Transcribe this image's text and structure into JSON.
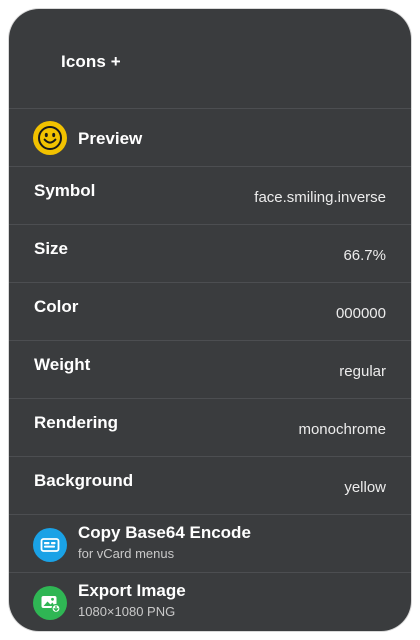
{
  "header": {
    "title": "Icons +"
  },
  "preview": {
    "label": "Preview",
    "icon": "face-smiling-icon",
    "icon_color": "#f2c200"
  },
  "properties": [
    {
      "label": "Symbol",
      "value": "face.smiling.inverse"
    },
    {
      "label": "Size",
      "value": "66.7%"
    },
    {
      "label": "Color",
      "value": "000000"
    },
    {
      "label": "Weight",
      "value": "regular"
    },
    {
      "label": "Rendering",
      "value": "monochrome"
    },
    {
      "label": "Background",
      "value": "yellow"
    }
  ],
  "actions": [
    {
      "title": "Copy Base64 Encode",
      "subtitle": "for vCard menus",
      "icon": "id-card-icon",
      "color": "#1aa2e6"
    },
    {
      "title": "Export Image",
      "subtitle": "1080×1080 PNG",
      "icon": "photo-export-icon",
      "color": "#2fb654"
    }
  ],
  "colors": {
    "card_background": "#3a3c3e",
    "divider": "#4c4e51"
  }
}
